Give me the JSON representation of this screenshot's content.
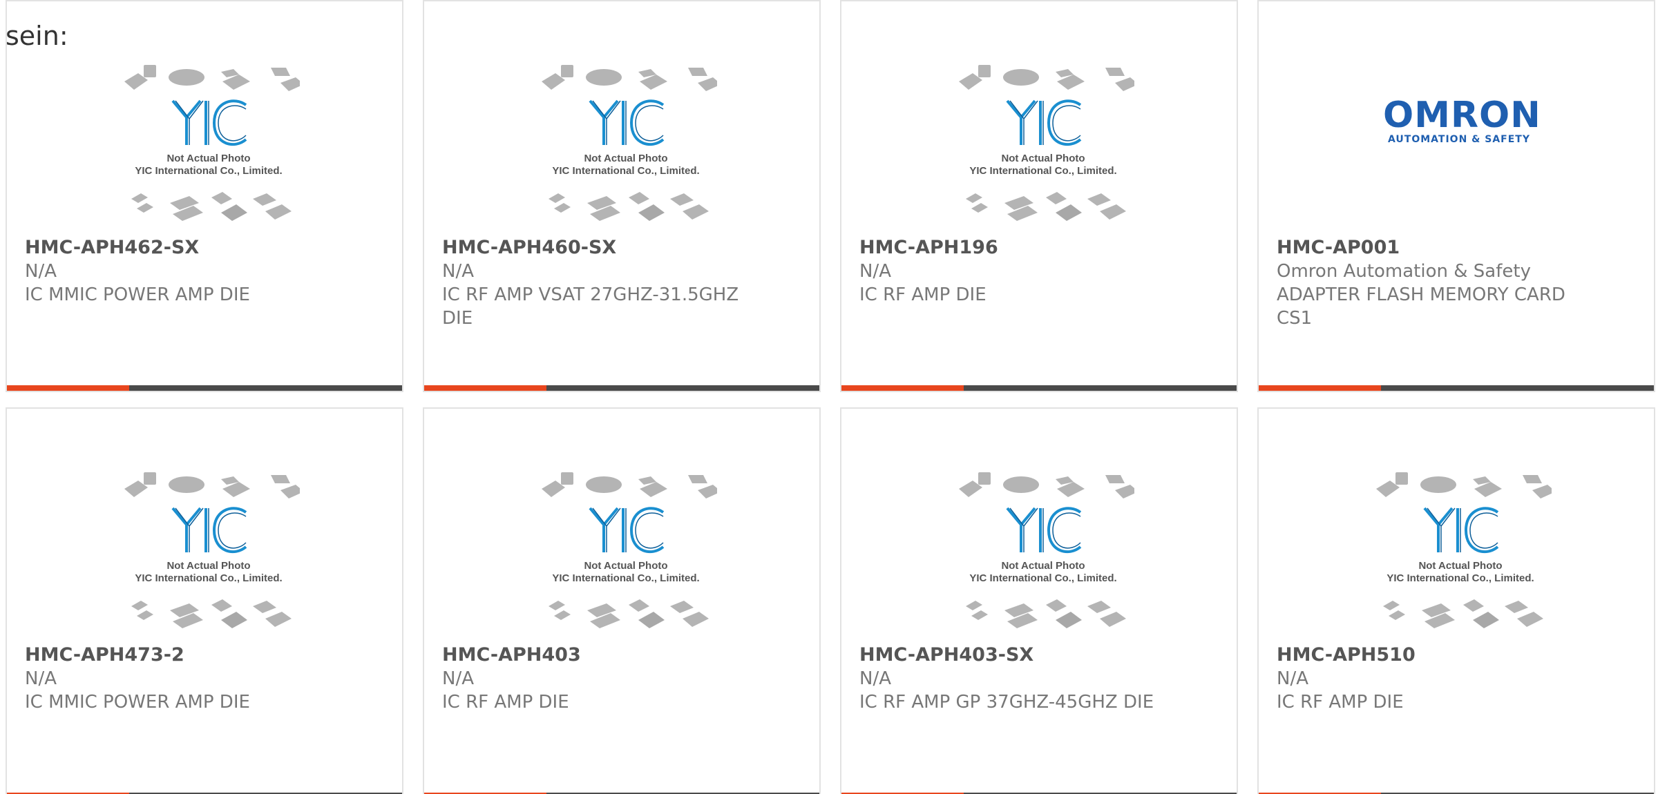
{
  "intro": {
    "text": "sein:"
  },
  "placeholder": {
    "line1": "Not Actual Photo",
    "line2": "YIC International Co., Limited.",
    "logo_text": "YIC"
  },
  "brand_logo": {
    "word": "OMRON",
    "tagline": "AUTOMATION & SAFETY"
  },
  "colors": {
    "accent": "#e8461e",
    "bar_dark": "#4a4a4a",
    "yic_blue": "#1a8fd0",
    "omron_blue": "#1f5fb0",
    "chip_gray": "#b4b4b4"
  },
  "progress_fraction": 0.31,
  "products": [
    {
      "part": "HMC-APH462-SX",
      "manufacturer": "N/A",
      "description": "IC MMIC POWER AMP DIE",
      "image": "yic-placeholder"
    },
    {
      "part": "HMC-APH460-SX",
      "manufacturer": "N/A",
      "description": "IC RF AMP VSAT 27GHZ-31.5GHZ DIE",
      "image": "yic-placeholder"
    },
    {
      "part": "HMC-APH196",
      "manufacturer": "N/A",
      "description": "IC RF AMP DIE",
      "image": "yic-placeholder"
    },
    {
      "part": "HMC-AP001",
      "manufacturer": "Omron Automation & Safety",
      "description": "ADAPTER FLASH MEMORY CARD CS1",
      "image": "omron-logo"
    },
    {
      "part": "HMC-APH473-2",
      "manufacturer": "N/A",
      "description": "IC MMIC POWER AMP DIE",
      "image": "yic-placeholder"
    },
    {
      "part": "HMC-APH403",
      "manufacturer": "N/A",
      "description": "IC RF AMP DIE",
      "image": "yic-placeholder"
    },
    {
      "part": "HMC-APH403-SX",
      "manufacturer": "N/A",
      "description": "IC RF AMP GP 37GHZ-45GHZ DIE",
      "image": "yic-placeholder"
    },
    {
      "part": "HMC-APH510",
      "manufacturer": "N/A",
      "description": "IC RF AMP DIE",
      "image": "yic-placeholder"
    }
  ]
}
